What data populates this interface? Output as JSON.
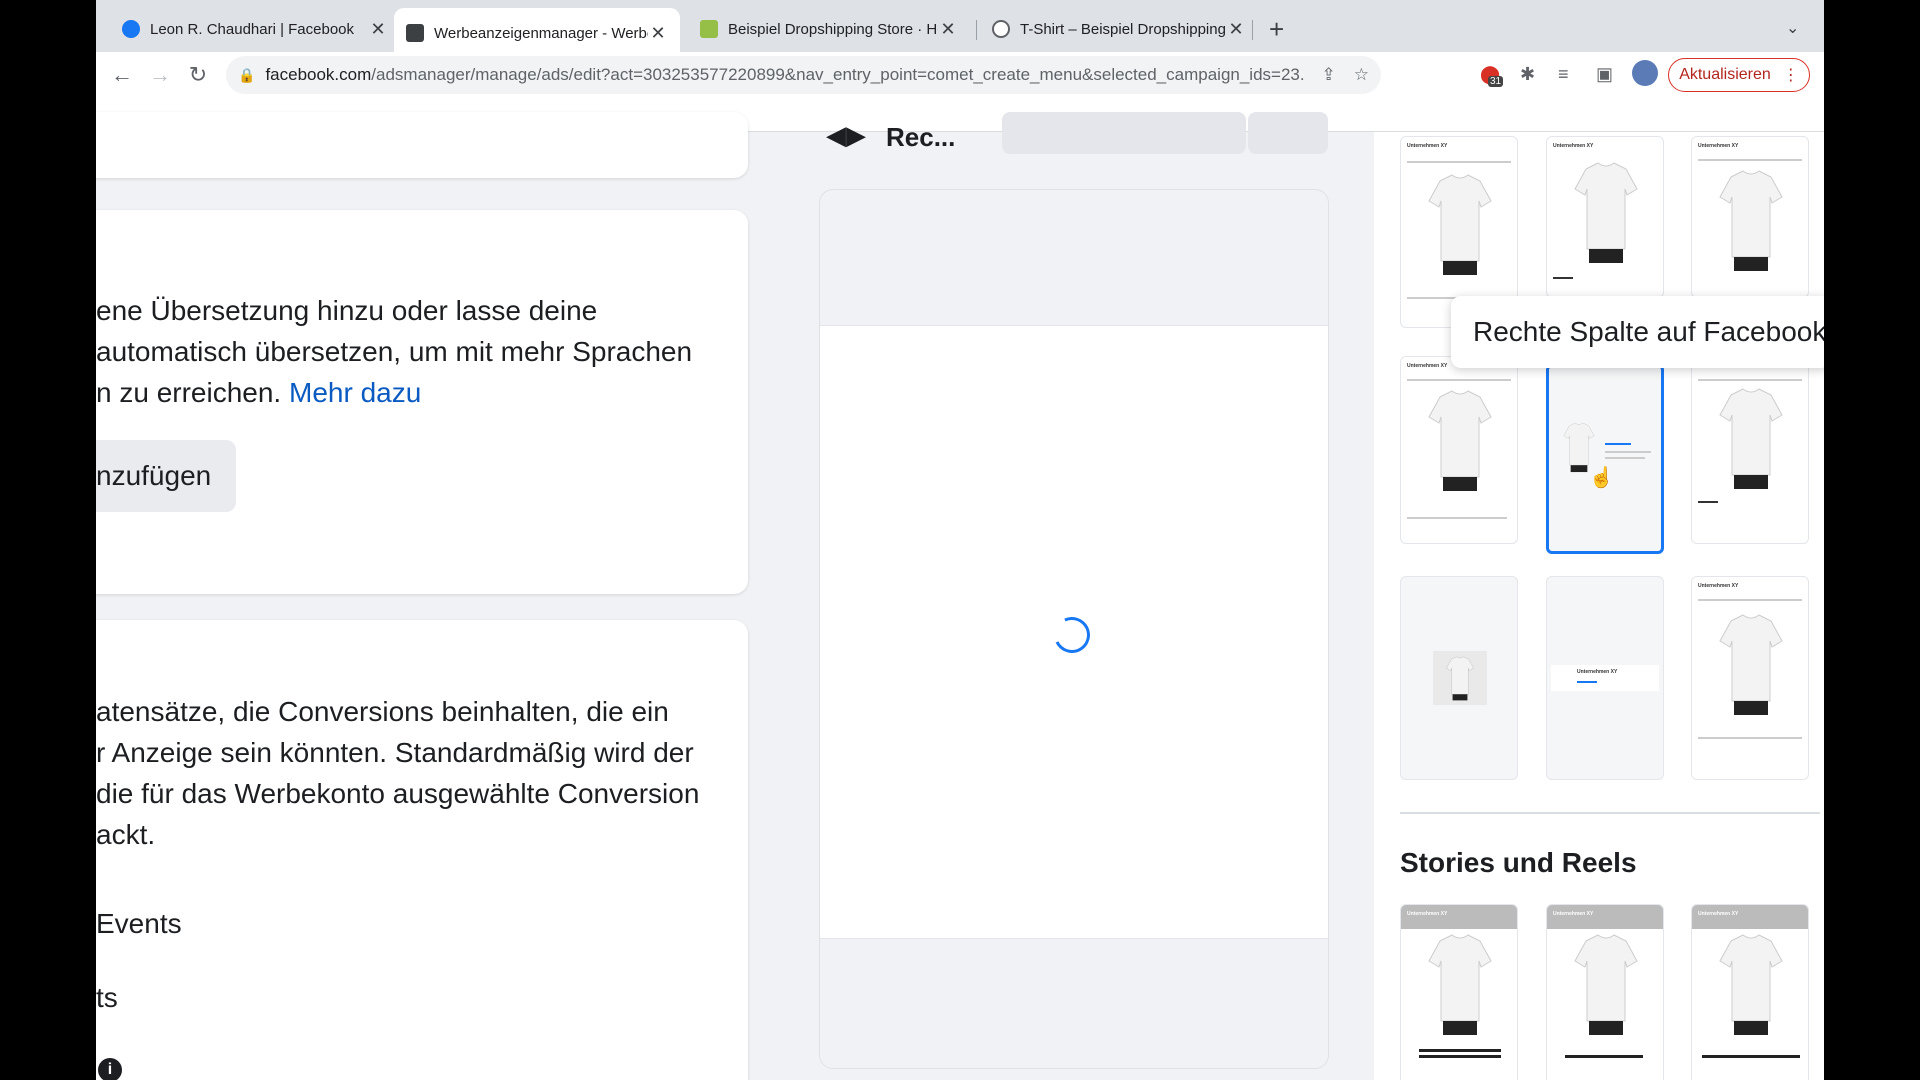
{
  "browser": {
    "tabs": [
      {
        "title": "Leon R. Chaudhari | Facebook",
        "favicon_color": "#1877f2"
      },
      {
        "title": "Werbeanzeigenmanager - Werbeanzeigen",
        "favicon_color": "#3c4043"
      },
      {
        "title": "Beispiel Dropshipping Store · Home",
        "favicon_color": "#95bf47"
      },
      {
        "title": "T-Shirt – Beispiel Dropshipping Store",
        "favicon_color": "#5f6368"
      }
    ],
    "url_host": "facebook.com",
    "url_path": "/adsmanager/manage/ads/edit?act=303253577220899&nav_entry_point=comet_create_menu&selected_campaign_ids=23...",
    "extension_badge": "31",
    "update_label": "Aktualisieren"
  },
  "left": {
    "translation_text": [
      "ene Übersetzung hinzu oder lasse deine",
      "automatisch übersetzen, um mit mehr Sprachen",
      "n zu erreichen."
    ],
    "more_link": "Mehr dazu",
    "add_button": "nzufügen",
    "datasets_text": [
      "atensätze, die Conversions beinhalten, die ein",
      "r Anzeige sein könnten. Standardmäßig wird der",
      "die für das Werbekonto ausgewählte Conversion",
      "ackt."
    ],
    "option_events": "Events",
    "option_ts": "ts"
  },
  "preview": {
    "title": "Rec..."
  },
  "placements": {
    "tooltip": "Rechte Spalte auf Facebook",
    "thumb_header": "Unternehmen XY",
    "stories_title": "Stories und Reels"
  },
  "colors": {
    "accent": "#1877f2",
    "link": "#0a5ac2",
    "update_red": "#d93025"
  }
}
